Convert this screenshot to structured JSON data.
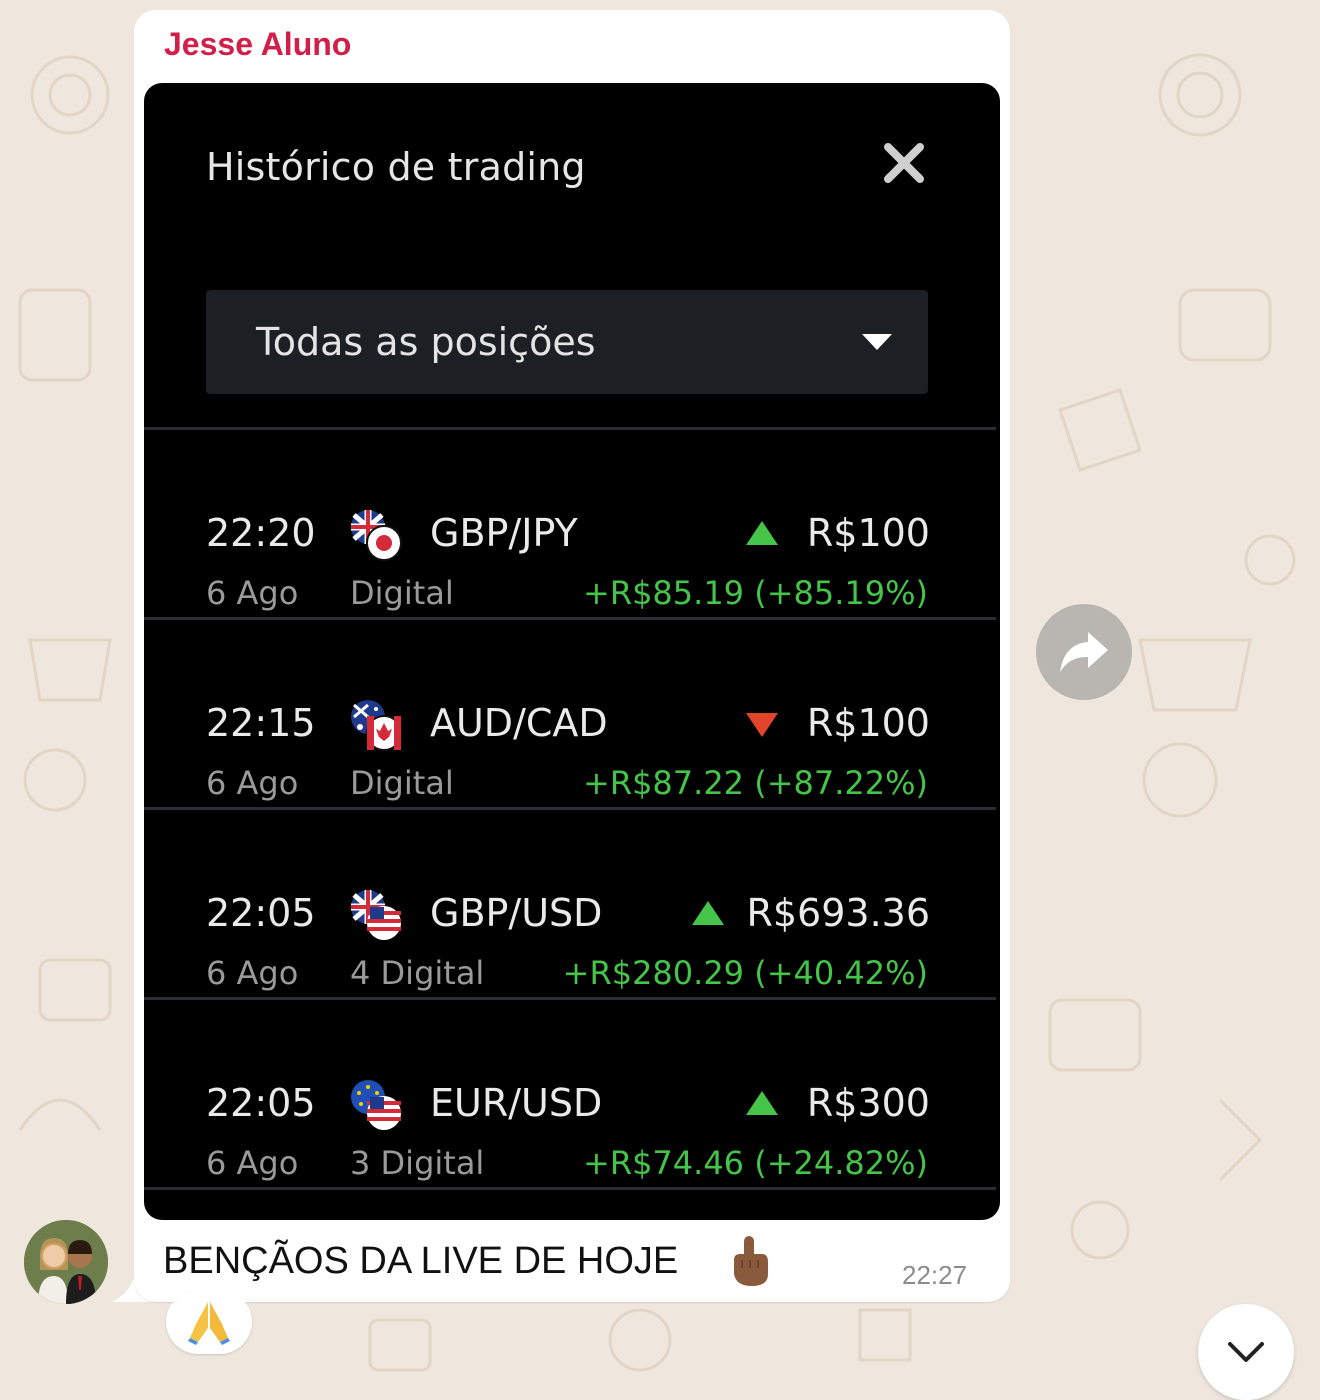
{
  "chat": {
    "sender_name": "Jesse Aluno",
    "caption": "BENÇÃOS DA LIVE DE HOJE",
    "timestamp": "22:27",
    "reaction_icon": "folded-hands-emoji",
    "caption_emoji": "pointing-up-emoji"
  },
  "trading_panel": {
    "title": "Histórico de trading",
    "filter_selected": "Todas as posições",
    "colors": {
      "up": "#45c44a",
      "down": "#e3452b",
      "profit": "#45c44a"
    },
    "rows": [
      {
        "time": "22:20",
        "date": "6 Ago",
        "pair": "GBP/JPY",
        "kind": "Digital",
        "direction": "up",
        "amount": "R$100",
        "profit": "+R$85.19 (+85.19%)"
      },
      {
        "time": "22:15",
        "date": "6 Ago",
        "pair": "AUD/CAD",
        "kind": "Digital",
        "direction": "down",
        "amount": "R$100",
        "profit": "+R$87.22 (+87.22%)"
      },
      {
        "time": "22:05",
        "date": "6 Ago",
        "pair": "GBP/USD",
        "kind": "4  Digital",
        "direction": "up",
        "amount": "R$693.36",
        "profit": "+R$280.29 (+40.42%)"
      },
      {
        "time": "22:05",
        "date": "6 Ago",
        "pair": "EUR/USD",
        "kind": "3  Digital",
        "direction": "up",
        "amount": "R$300",
        "profit": "+R$74.46 (+24.82%)"
      }
    ]
  }
}
